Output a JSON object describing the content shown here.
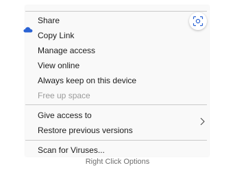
{
  "context_menu": {
    "group1": [
      {
        "label": "Share",
        "disabled": false
      },
      {
        "label": "Copy Link",
        "disabled": false
      },
      {
        "label": "Manage access",
        "disabled": false
      },
      {
        "label": "View online",
        "disabled": false
      },
      {
        "label": "Always keep on this device",
        "disabled": false
      },
      {
        "label": "Free up space",
        "disabled": true
      }
    ],
    "group2": [
      {
        "label": "Give access to",
        "disabled": false,
        "has_submenu": true
      },
      {
        "label": "Restore previous versions",
        "disabled": false
      }
    ],
    "group3": [
      {
        "label": "Scan for Viruses...",
        "disabled": false
      }
    ]
  },
  "icons": {
    "share": "onedrive-cloud-icon",
    "lens": "visual-search-icon",
    "submenu": "chevron-right-icon"
  },
  "colors": {
    "menu_background": "#f9f9f9",
    "text": "#1b1b1b",
    "disabled_text": "#9a9a9a",
    "accent": "#2b63d4"
  },
  "caption": "Right Click Options"
}
